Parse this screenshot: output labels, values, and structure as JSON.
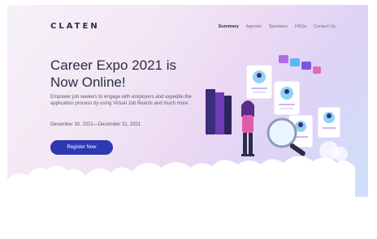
{
  "brand": "CLATEN",
  "nav": {
    "items": [
      "Summary",
      "Agenda",
      "Speakers",
      "FAQs",
      "Contact Us"
    ],
    "active": "Summary"
  },
  "hero": {
    "title_line1": "Career Expo 2021 is",
    "title_line2": "Now Online!",
    "description": "Empower job seekers to engage with employers and expedite the application process by using Virtual Job Boards and much more.",
    "dates": "December 30, 2021—December 31, 2021",
    "cta_label": "Register Now"
  },
  "colors": {
    "accent": "#2d39b3",
    "heading": "#2a2d46",
    "gradient_start": "#f6f1f8",
    "gradient_end": "#cfe0f8"
  },
  "illustration": {
    "icons": [
      "profile-card-icon",
      "person-icon",
      "books-icon",
      "magnifier-icon",
      "cloud-icon",
      "chat-icon"
    ]
  }
}
